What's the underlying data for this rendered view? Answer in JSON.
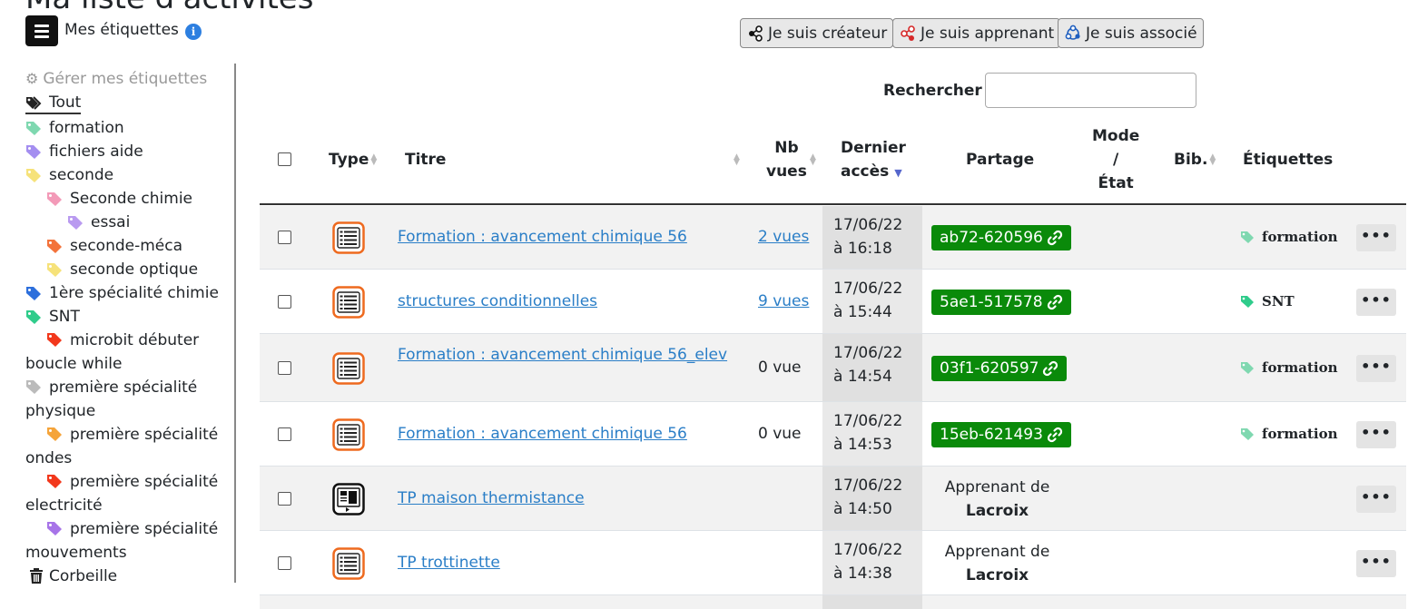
{
  "page_title": "Ma liste d'activités",
  "header": {
    "tags_title": "Mes étiquettes",
    "info": "i"
  },
  "roles": [
    {
      "label": "Je suis créateur",
      "icon": "share-nodes-icon",
      "color": "#111111"
    },
    {
      "label": "Je suis apprenant",
      "icon": "share-nodes-icon",
      "color": "#d62828"
    },
    {
      "label": "Je suis associé",
      "icon": "circle-nodes-icon",
      "color": "#1f5fbf"
    }
  ],
  "sidebar": {
    "manage": "Gérer mes étiquettes",
    "all": "Tout",
    "items": [
      {
        "label": "formation",
        "color": "#7fd8b0",
        "indent": 0
      },
      {
        "label": "fichiers aide",
        "color": "#a48ef0",
        "indent": 0
      },
      {
        "label": "seconde",
        "color": "#f6e27a",
        "indent": 0
      },
      {
        "label": "Seconde chimie",
        "color": "#f39ab8",
        "indent": 1
      },
      {
        "label": "essai",
        "color": "#b99af0",
        "indent": 2
      },
      {
        "label": "seconde-méca",
        "color": "#f3733b",
        "indent": 1
      },
      {
        "label": "seconde optique",
        "color": "#f6e27a",
        "indent": 1
      },
      {
        "label": "1ère spécialité chimie",
        "color": "#2d6fdc",
        "indent": 0
      },
      {
        "label": "SNT",
        "color": "#2fcc8b",
        "indent": 0
      },
      {
        "label": "microbit débuter boucle while",
        "color": "#f2381c",
        "indent": 1
      },
      {
        "label": "première spécialité physique",
        "color": "#bbbbbb",
        "indent": 0
      },
      {
        "label": "première spécialité ondes",
        "color": "#f5a43a",
        "indent": 1
      },
      {
        "label": "première spécialité electricité",
        "color": "#f2381c",
        "indent": 1
      },
      {
        "label": "première spécialité mouvements",
        "color": "#a774e8",
        "indent": 1
      }
    ],
    "trash": "Corbeille"
  },
  "search": {
    "label": "Rechercher",
    "placeholder": ""
  },
  "table": {
    "headers": {
      "type": "Type",
      "title": "Titre",
      "views_1": "Nb",
      "views_2": "vues",
      "last_1": "Dernier",
      "last_2": "accès",
      "share": "Partage",
      "mode_1": "Mode",
      "mode_2": "/",
      "mode_3": "État",
      "bib": "Bib.",
      "tags": "Étiquettes"
    },
    "rows": [
      {
        "type": "list",
        "title": "Formation : avancement chimique 56",
        "views": "2 vues",
        "views_link": true,
        "date": "17/06/22",
        "time": "à 16:18",
        "share": "ab72-620596",
        "share_type": "code",
        "tag": "formation",
        "tag_color": "#7fd8b0",
        "more": "•••"
      },
      {
        "type": "list",
        "title": "structures conditionnelles",
        "views": "9 vues",
        "views_link": true,
        "date": "17/06/22",
        "time": "à 15:44",
        "share": "5ae1-517578",
        "share_type": "code",
        "tag": "SNT",
        "tag_color": "#2fcc8b",
        "more": "•••"
      },
      {
        "type": "list",
        "title": "Formation : avancement chimique 56_elev",
        "views": "0 vue",
        "views_link": false,
        "date": "17/06/22",
        "time": "à 14:54",
        "share": "03f1-620597",
        "share_type": "code",
        "tag": "formation",
        "tag_color": "#7fd8b0",
        "more": "•••"
      },
      {
        "type": "list",
        "title": "Formation : avancement chimique 56",
        "views": "0 vue",
        "views_link": false,
        "date": "17/06/22",
        "time": "à 14:53",
        "share": "15eb-621493",
        "share_type": "code",
        "tag": "formation",
        "tag_color": "#7fd8b0",
        "more": "•••"
      },
      {
        "type": "slides",
        "title": "TP maison thermistance",
        "views": "",
        "views_link": false,
        "date": "17/06/22",
        "time": "à 14:50",
        "share_line1": "Apprenant de",
        "share_line2": "Lacroix",
        "share_type": "learner",
        "tag": "",
        "more": "•••"
      },
      {
        "type": "list",
        "title": "TP trottinette",
        "views": "",
        "views_link": false,
        "date": "17/06/22",
        "time": "à 14:38",
        "share_line1": "Apprenant de",
        "share_line2": "Lacroix",
        "share_type": "learner",
        "tag": "",
        "more": "•••"
      }
    ]
  }
}
